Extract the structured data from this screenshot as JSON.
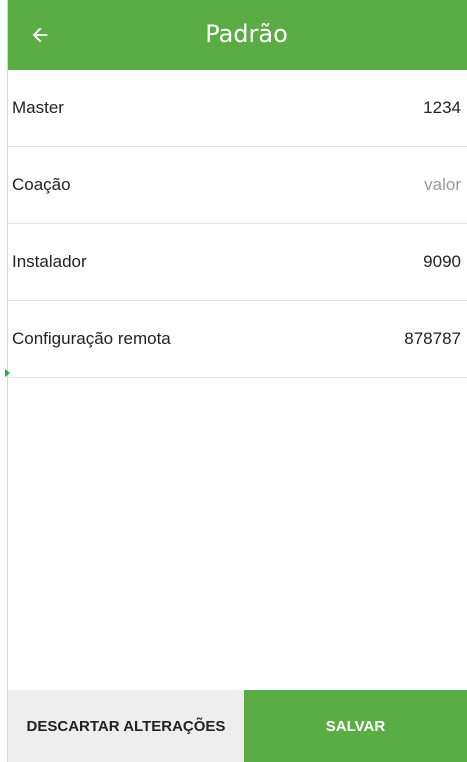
{
  "header": {
    "title": "Padrão",
    "back_icon": "arrow-left-icon"
  },
  "codes": [
    {
      "label": "Master",
      "value": "1234",
      "is_placeholder": false
    },
    {
      "label": "Coação",
      "value": "valor",
      "is_placeholder": true
    },
    {
      "label": "Instalador",
      "value": "9090",
      "is_placeholder": false
    },
    {
      "label": "Configuração remota",
      "value": "878787",
      "is_placeholder": false
    }
  ],
  "actions": {
    "discard_label": "DESCARTAR ALTERAÇÕES",
    "save_label": "SALVAR"
  },
  "colors": {
    "brand_green": "#5aac44",
    "placeholder_gray": "#9a9a9a"
  }
}
